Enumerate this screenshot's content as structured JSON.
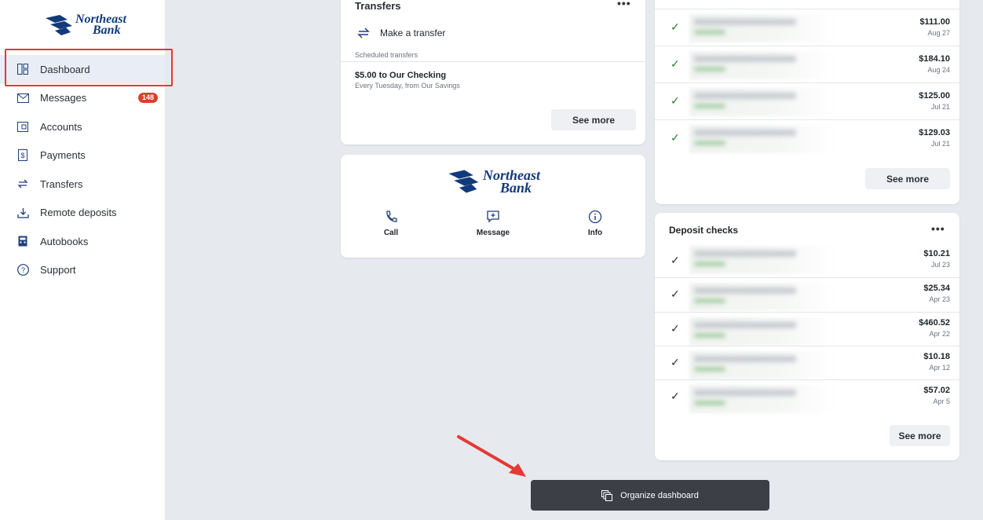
{
  "brand": {
    "line1": "Northeast",
    "line2": "Bank",
    "color": "#123a7a"
  },
  "sidebar": {
    "items": [
      {
        "label": "Dashboard",
        "icon": "dashboard-icon"
      },
      {
        "label": "Messages",
        "icon": "envelope-icon",
        "badge": "148"
      },
      {
        "label": "Accounts",
        "icon": "wallet-icon"
      },
      {
        "label": "Payments",
        "icon": "dollar-document-icon"
      },
      {
        "label": "Transfers",
        "icon": "transfer-arrows-icon"
      },
      {
        "label": "Remote deposits",
        "icon": "download-tray-icon"
      },
      {
        "label": "Autobooks",
        "icon": "calculator-icon"
      },
      {
        "label": "Support",
        "icon": "question-circle-icon"
      }
    ],
    "highlight_color": "#e53935",
    "badge_color": "#d9402b"
  },
  "transfers": {
    "title": "Transfers",
    "menu": "•••",
    "make_transfer": "Make a transfer",
    "scheduled_label": "Scheduled transfers",
    "scheduled_title": "$5.00 to Our Checking",
    "scheduled_sub": "Every Tuesday, from Our Savings",
    "see_more": "See more"
  },
  "contact": {
    "actions": [
      {
        "label": "Call",
        "icon": "phone-icon"
      },
      {
        "label": "Message",
        "icon": "chat-icon"
      },
      {
        "label": "Info",
        "icon": "info-icon"
      }
    ]
  },
  "recent": {
    "rows": [
      {
        "amount": "$111.00",
        "date": "Aug 27"
      },
      {
        "amount": "$184.10",
        "date": "Aug 24"
      },
      {
        "amount": "$125.00",
        "date": "Jul 21"
      },
      {
        "amount": "$129.03",
        "date": "Jul 21"
      }
    ],
    "see_more": "See more"
  },
  "deposit": {
    "title": "Deposit checks",
    "menu": "•••",
    "rows": [
      {
        "amount": "$10.21",
        "date": "Jul 23"
      },
      {
        "amount": "$25.34",
        "date": "Apr 23"
      },
      {
        "amount": "$460.52",
        "date": "Apr 22"
      },
      {
        "amount": "$10.18",
        "date": "Apr 12"
      },
      {
        "amount": "$57.02",
        "date": "Apr 5"
      }
    ],
    "see_more": "See more"
  },
  "organize": {
    "label": "Organize dashboard",
    "icon": "layers-icon"
  },
  "annotation": {
    "arrow_color": "#e53935"
  }
}
